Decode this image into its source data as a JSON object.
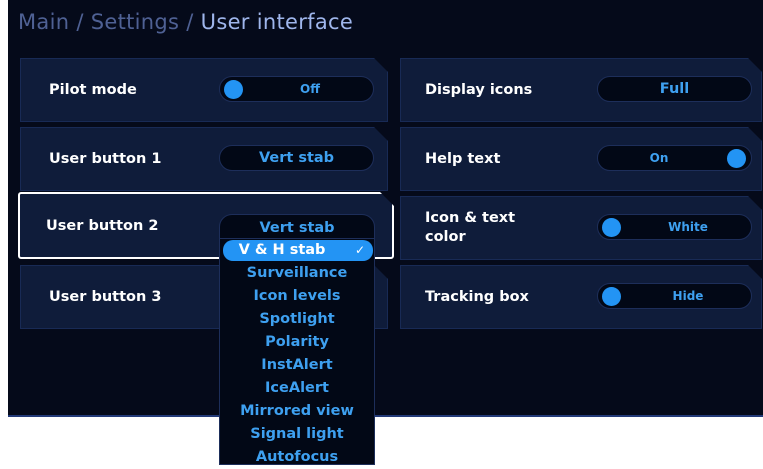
{
  "breadcrumb": {
    "items": [
      "Main",
      "Settings"
    ],
    "separator": "/",
    "current": "User interface"
  },
  "settings": {
    "pilot_mode": {
      "label": "Pilot mode",
      "value": "Off",
      "toggle_on": false
    },
    "user_button_1": {
      "label": "User button 1",
      "value": "Vert stab"
    },
    "user_button_2": {
      "label": "User button 2",
      "value": "Vert stab",
      "dropdown_open": true
    },
    "user_button_3": {
      "label": "User button 3"
    },
    "display_icons": {
      "label": "Display icons",
      "value": "Full"
    },
    "help_text": {
      "label": "Help text",
      "value": "On",
      "toggle_on": true
    },
    "icon_text_color": {
      "label": "Icon & text color",
      "value": "White"
    },
    "tracking_box": {
      "label": "Tracking box",
      "value": "Hide"
    }
  },
  "dropdown": {
    "selected": "V & H stab",
    "check_mark": "✓",
    "options": [
      "V & H stab",
      "Surveillance",
      "Icon levels",
      "Spotlight",
      "Polarity",
      "InstAlert",
      "IceAlert",
      "Mirrored view",
      "Signal light",
      "Autofocus"
    ]
  },
  "colors": {
    "background": "#050a1a",
    "card": "#0f1c3a",
    "accent": "#2394f4",
    "value_text": "#3ea0f0",
    "breadcrumb_dim": "#4f6194",
    "breadcrumb_current": "#9fb6ec"
  },
  "icons": {
    "selected_option": "check-icon"
  }
}
